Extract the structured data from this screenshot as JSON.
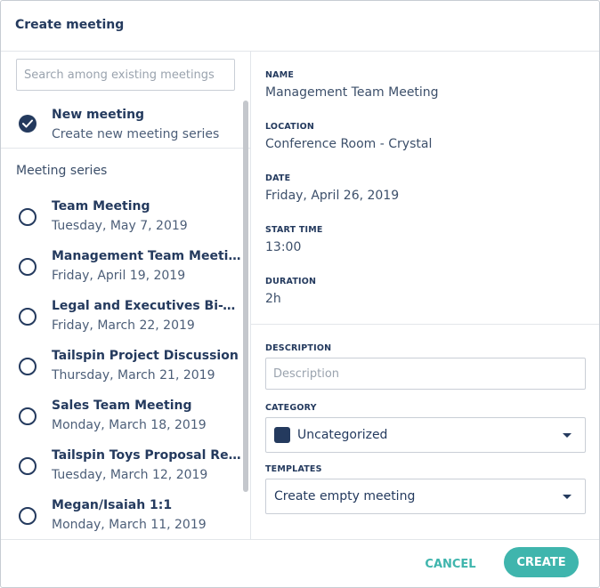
{
  "dialog": {
    "title": "Create meeting"
  },
  "search": {
    "placeholder": "Search among existing meetings"
  },
  "new_meeting": {
    "title": "New meeting",
    "subtitle": "Create new meeting series"
  },
  "series_heading": "Meeting series",
  "series": [
    {
      "title": "Team Meeting",
      "date": "Tuesday, May 7, 2019"
    },
    {
      "title": "Management Team Meeting",
      "date": "Friday, April 19, 2019"
    },
    {
      "title": "Legal and Executives Bi-Weekly",
      "date": "Friday, March 22, 2019"
    },
    {
      "title": "Tailspin Project Discussion",
      "date": "Thursday, March 21, 2019"
    },
    {
      "title": "Sales Team Meeting",
      "date": "Monday, March 18, 2019"
    },
    {
      "title": "Tailspin Toys Proposal Review",
      "date": "Tuesday, March 12, 2019"
    },
    {
      "title": "Megan/Isaiah 1:1",
      "date": "Monday, March 11, 2019"
    }
  ],
  "details": {
    "name_label": "NAME",
    "name_value": "Management Team Meeting",
    "location_label": "LOCATION",
    "location_value": "Conference Room - Crystal",
    "date_label": "DATE",
    "date_value": "Friday, April 26, 2019",
    "start_label": "START TIME",
    "start_value": "13:00",
    "duration_label": "DURATION",
    "duration_value": "2h"
  },
  "form": {
    "description_label": "DESCRIPTION",
    "description_placeholder": "Description",
    "category_label": "CATEGORY",
    "category_value": "Uncategorized",
    "category_color": "#243a5e",
    "templates_label": "TEMPLATES",
    "templates_value": "Create empty meeting"
  },
  "footer": {
    "cancel_label": "CANCEL",
    "create_label": "CREATE"
  },
  "colors": {
    "accent": "#3fb5ad",
    "primary": "#243a5e"
  }
}
